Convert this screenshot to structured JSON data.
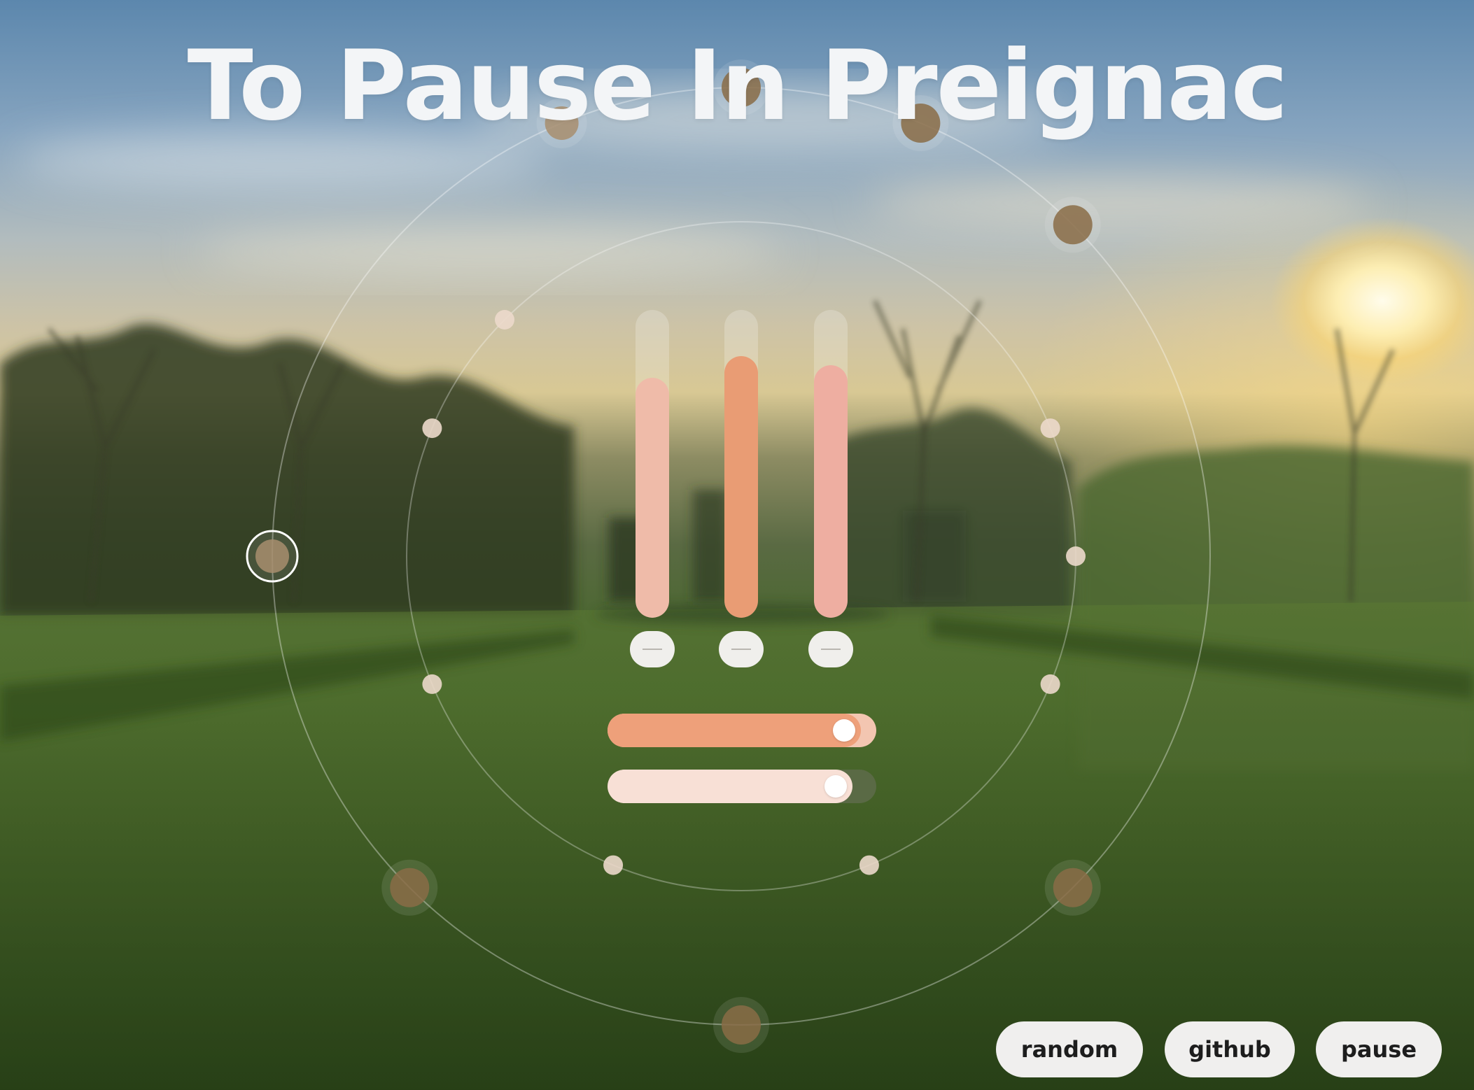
{
  "title": "To Pause In Preignac",
  "colors": {
    "accent_orange": "#eea07a",
    "pale_peach": "#f8e0d6",
    "ring_line": "#ffffff",
    "button_bg": "#f0efee",
    "title_color": "#f3f5f7"
  },
  "vertical_sliders": [
    {
      "name": "slider-1",
      "level": 0.78,
      "color": "#efbba9"
    },
    {
      "name": "slider-2",
      "level": 0.85,
      "color": "#e99c74"
    },
    {
      "name": "slider-3",
      "level": 0.82,
      "color": "#eeaea1"
    }
  ],
  "minus_buttons": [
    {
      "icon": "minus-icon"
    },
    {
      "icon": "minus-icon"
    },
    {
      "icon": "minus-icon"
    }
  ],
  "horizontal_sliders": [
    {
      "name": "speed",
      "level": 0.88,
      "fill": "#eea07a",
      "track": "#f3c6b1"
    },
    {
      "name": "volume",
      "level": 0.85,
      "fill": "#f8e0d6",
      "track": "#5a6a45"
    }
  ],
  "nodes": {
    "count": 16,
    "selected_index": 12,
    "sizes": [
      "lg",
      "lg",
      "lg",
      "sm",
      "sm",
      "sm",
      "lg",
      "sm",
      "lg",
      "sm",
      "lg",
      "sm",
      "md",
      "sm",
      "sm",
      "md"
    ]
  },
  "nav": {
    "random": "random",
    "github": "github",
    "pause": "pause"
  }
}
